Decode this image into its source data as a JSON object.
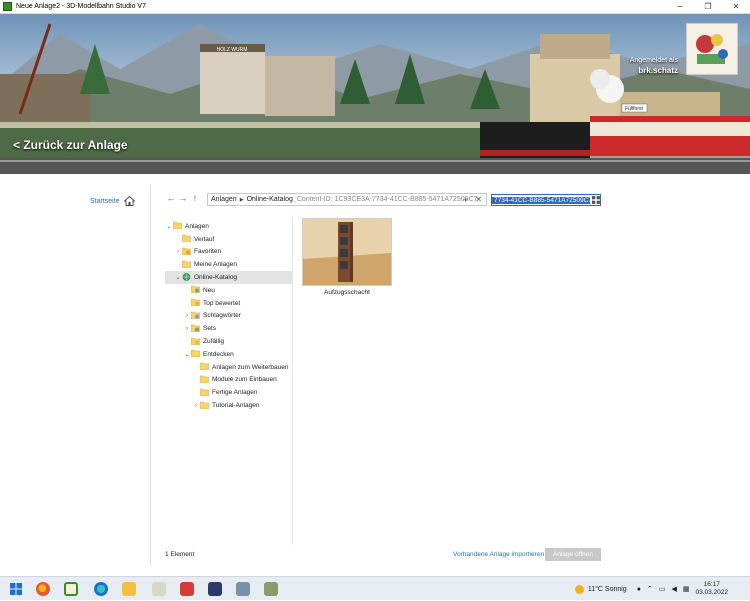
{
  "window": {
    "title": "Neue Anlage2 - 3D-Modellbahn Studio V7",
    "minimize": "─",
    "maximize": "❐",
    "close": "✕"
  },
  "banner": {
    "back_label": "< Zurück zur Anlage",
    "login_prefix": "Angemeldet als",
    "username": "brk.schatz",
    "sign_text": "HOLZ WURM",
    "station_sign": "Füllforst"
  },
  "sidebar": {
    "home_label": "Startseite"
  },
  "nav": {
    "back": "←",
    "forward": "→",
    "up": "↑",
    "breadcrumb": [
      "Anlagen",
      "Online-Katalog"
    ],
    "content_id": "Content-ID: 1C93CE3A-7734-41CC-B885-5471A72509C7",
    "search_value": "7734-41CC-B885-5471A72509C7"
  },
  "tree": [
    {
      "label": "Anlagen",
      "level": 0,
      "twisty": "v",
      "icon": "folder-icon"
    },
    {
      "label": "Verlauf",
      "level": 1,
      "twisty": "",
      "icon": "history-icon"
    },
    {
      "label": "Favoriten",
      "level": 1,
      "twisty": ">",
      "icon": "star-folder-icon"
    },
    {
      "label": "Meine Anlagen",
      "level": 1,
      "twisty": "",
      "icon": "folder-icon"
    },
    {
      "label": "Online-Katalog",
      "level": 1,
      "twisty": "v",
      "icon": "globe-icon",
      "selected": true
    },
    {
      "label": "Neu",
      "level": 2,
      "twisty": "",
      "icon": "new-icon"
    },
    {
      "label": "Top bewertet",
      "level": 2,
      "twisty": "",
      "icon": "trophy-icon"
    },
    {
      "label": "Schlagwörter",
      "level": 2,
      "twisty": ">",
      "icon": "tags-icon"
    },
    {
      "label": "Sets",
      "level": 2,
      "twisty": ">",
      "icon": "sets-icon"
    },
    {
      "label": "Zufällig",
      "level": 2,
      "twisty": "",
      "icon": "random-icon"
    },
    {
      "label": "Entdecken",
      "level": 2,
      "twisty": "v",
      "icon": "folder-icon"
    },
    {
      "label": "Anlagen zum Weiterbauen",
      "level": 3,
      "twisty": "",
      "icon": "folder-icon"
    },
    {
      "label": "Module zum Einbauen",
      "level": 3,
      "twisty": "",
      "icon": "folder-icon"
    },
    {
      "label": "Fertige Anlagen",
      "level": 3,
      "twisty": "",
      "icon": "folder-icon"
    },
    {
      "label": "Tutorial-Anlagen",
      "level": 3,
      "twisty": ">",
      "icon": "folder-icon"
    }
  ],
  "items": [
    {
      "label": "Aufzugsschacht"
    }
  ],
  "footer": {
    "count": "1 Element",
    "import_link": "Vorhandene Anlage importieren",
    "open_button": "Anlage öffnen"
  },
  "taskbar": {
    "weather": "11°C  Sonnig",
    "time": "16:17",
    "date": "03.03.2022"
  },
  "colors": {
    "accent": "#2f6ab8",
    "link": "#2a6fb0",
    "folder": "#f6d36b",
    "selected_row": "#e3e3e3"
  }
}
